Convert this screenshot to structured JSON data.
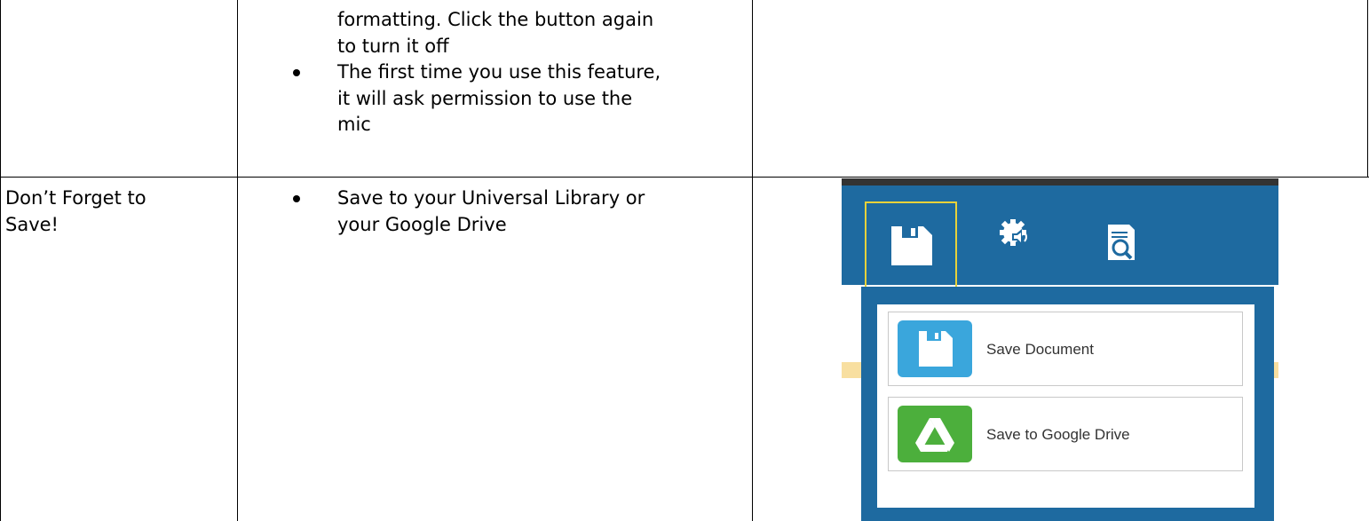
{
  "table": {
    "row1": {
      "bullets": [
        {
          "lines": [
            "formatting. Click the button again",
            "to turn it off"
          ],
          "continuation": true
        },
        {
          "lines": [
            "The first time you use this feature,",
            "it will ask permission to use the",
            "mic"
          ],
          "continuation": false
        }
      ]
    },
    "row2": {
      "title_lines": [
        "Don’t Forget to",
        "Save!"
      ],
      "bullets": [
        {
          "lines": [
            "Save to your Universal Library or",
            "your Google Drive"
          ],
          "continuation": false
        }
      ]
    }
  },
  "screenshot": {
    "toolbar_icons": [
      "save-icon",
      "speech-settings-icon",
      "document-search-icon"
    ],
    "menu": [
      {
        "label": "Save Document",
        "icon": "floppy-icon",
        "color": "#3aa6dc"
      },
      {
        "label": "Save to Google Drive",
        "icon": "google-drive-icon",
        "color": "#4caf3c"
      }
    ],
    "colors": {
      "toolbar": "#1e6aa0",
      "focus_outline": "#e8d23a",
      "strip": "#f8dfa0"
    }
  }
}
